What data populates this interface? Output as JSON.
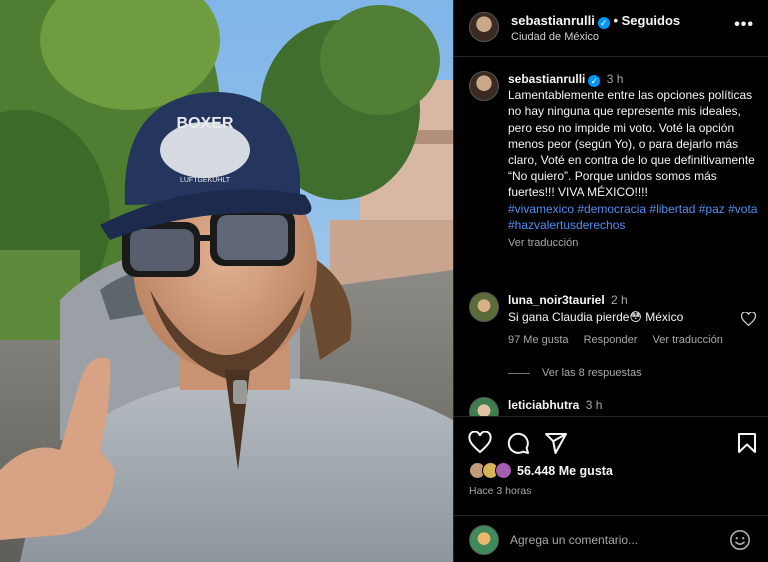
{
  "post": {
    "username": "sebastianrulli",
    "follow_status": "Seguidos",
    "location": "Ciudad de México",
    "time": "3 h",
    "caption": "Lamentablemente entre las opciones políticas no hay ninguna que represente mis ideales, pero eso no impide mi voto. Voté la opción menos peor (según Yo), o para dejarlo más claro, Voté en contra de lo que definitivamente “No quiero”. Porque unidos somos más fuertes!!! VIVA MÉXICO!!!!",
    "hashtags": "#vivamexico #democracia #libertad #paz #vota #hazvalertusderechos",
    "see_translation": "Ver traducción",
    "photo_cap_text_1": "BOXER",
    "photo_cap_text_2": "LUFTGEKÜHLT"
  },
  "comments": [
    {
      "username": "luna_noir3tauriel",
      "time": "2 h",
      "text": "Si gana Claudia pierde😳 México",
      "likes": "97 Me gusta",
      "reply": "Responder",
      "see_translation": "Ver traducción",
      "view_replies": "Ver las 8 respuestas"
    },
    {
      "username": "leticiabhutra",
      "time": "3 h"
    }
  ],
  "footer": {
    "likes": "56.448 Me gusta",
    "posted_ago": "Hace 3 horas",
    "comment_placeholder": "Agrega un comentario..."
  },
  "icons": {
    "heart": "heart-icon",
    "comment": "comment-icon",
    "share": "share-icon",
    "save": "bookmark-icon",
    "more": "more-icon",
    "emoji": "emoji-icon"
  },
  "colors": {
    "background": "#000000",
    "link": "#4d8ff0",
    "verified": "#0095f6",
    "muted": "#a8a8a8"
  }
}
